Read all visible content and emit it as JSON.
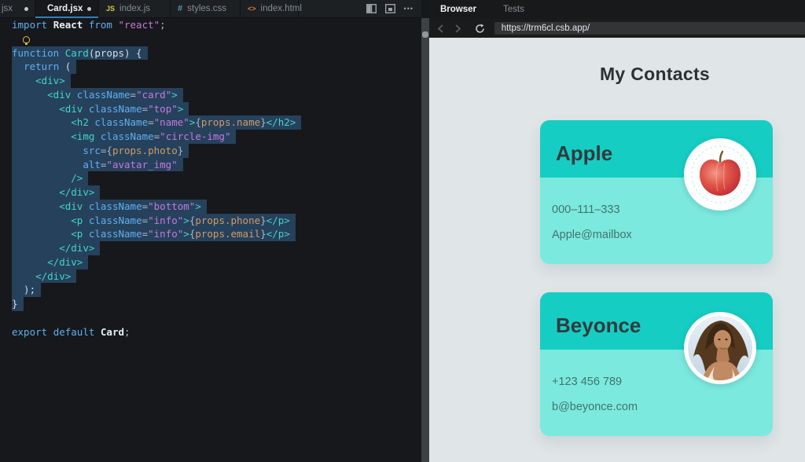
{
  "editor": {
    "tabs": [
      {
        "label": "jsx",
        "modified": true,
        "active": false
      },
      {
        "label": "Card.jsx",
        "icon": "react",
        "modified": true,
        "active": true
      },
      {
        "label": "index.js",
        "icon_text": "JS",
        "active": false
      },
      {
        "label": "styles.css",
        "icon_text": "#",
        "active": false
      },
      {
        "label": "index.html",
        "icon_text": "<>",
        "active": false
      }
    ],
    "more_icon": "•••",
    "code": {
      "lines": [
        {
          "t": [
            [
              "k",
              "import "
            ],
            [
              "w",
              "React"
            ],
            [
              "k",
              " from "
            ],
            [
              "s",
              "\"react\""
            ],
            [
              "p",
              ";"
            ]
          ]
        },
        {
          "bulb": true
        },
        {
          "sel": 1,
          "t": [
            [
              "k",
              "function "
            ],
            [
              "t",
              "Card"
            ],
            [
              "pl",
              "(props) {"
            ]
          ]
        },
        {
          "sel": 1,
          "t": [
            [
              "pl",
              "  "
            ],
            [
              "k",
              "return"
            ],
            [
              "pl",
              " ("
            ]
          ]
        },
        {
          "sel": 1,
          "t": [
            [
              "pl",
              "    "
            ],
            [
              "t",
              "<div>"
            ]
          ]
        },
        {
          "sel": 1,
          "t": [
            [
              "pl",
              "      "
            ],
            [
              "t",
              "<div"
            ],
            [
              "pl",
              " "
            ],
            [
              "a",
              "className"
            ],
            [
              "p",
              "="
            ],
            [
              "s",
              "\"card\""
            ],
            [
              "t",
              ">"
            ]
          ]
        },
        {
          "sel": 1,
          "t": [
            [
              "pl",
              "        "
            ],
            [
              "t",
              "<div"
            ],
            [
              "pl",
              " "
            ],
            [
              "a",
              "className"
            ],
            [
              "p",
              "="
            ],
            [
              "s",
              "\"top\""
            ],
            [
              "t",
              ">"
            ]
          ]
        },
        {
          "sel": 1,
          "t": [
            [
              "pl",
              "          "
            ],
            [
              "t",
              "<h2"
            ],
            [
              "pl",
              " "
            ],
            [
              "a",
              "className"
            ],
            [
              "p",
              "="
            ],
            [
              "s",
              "\"name\""
            ],
            [
              "t",
              ">"
            ],
            [
              "p",
              "{"
            ],
            [
              "o",
              "props.name"
            ],
            [
              "p",
              "}"
            ],
            [
              "t",
              "</h2>"
            ]
          ]
        },
        {
          "sel": 1,
          "t": [
            [
              "pl",
              "          "
            ],
            [
              "t",
              "<img"
            ],
            [
              "pl",
              " "
            ],
            [
              "a",
              "className"
            ],
            [
              "p",
              "="
            ],
            [
              "s",
              "\"circle-img\""
            ]
          ]
        },
        {
          "sel": 1,
          "t": [
            [
              "pl",
              "            "
            ],
            [
              "a",
              "src"
            ],
            [
              "p",
              "="
            ],
            [
              "p",
              "{"
            ],
            [
              "o",
              "props.photo"
            ],
            [
              "p",
              "}"
            ]
          ]
        },
        {
          "sel": 1,
          "t": [
            [
              "pl",
              "            "
            ],
            [
              "a",
              "alt"
            ],
            [
              "p",
              "="
            ],
            [
              "s",
              "\"avatar_img\""
            ]
          ]
        },
        {
          "sel": 1,
          "t": [
            [
              "pl",
              "          "
            ],
            [
              "t",
              "/>"
            ]
          ]
        },
        {
          "sel": 1,
          "t": [
            [
              "pl",
              "        "
            ],
            [
              "t",
              "</div>"
            ]
          ]
        },
        {
          "sel": 1,
          "t": [
            [
              "pl",
              "        "
            ],
            [
              "t",
              "<div"
            ],
            [
              "pl",
              " "
            ],
            [
              "a",
              "className"
            ],
            [
              "p",
              "="
            ],
            [
              "s",
              "\"bottom\""
            ],
            [
              "t",
              ">"
            ]
          ]
        },
        {
          "sel": 1,
          "t": [
            [
              "pl",
              "          "
            ],
            [
              "t",
              "<p"
            ],
            [
              "pl",
              " "
            ],
            [
              "a",
              "className"
            ],
            [
              "p",
              "="
            ],
            [
              "s",
              "\"info\""
            ],
            [
              "t",
              ">"
            ],
            [
              "p",
              "{"
            ],
            [
              "o",
              "props.phone"
            ],
            [
              "p",
              "}"
            ],
            [
              "t",
              "</p>"
            ]
          ]
        },
        {
          "sel": 1,
          "t": [
            [
              "pl",
              "          "
            ],
            [
              "t",
              "<p"
            ],
            [
              "pl",
              " "
            ],
            [
              "a",
              "className"
            ],
            [
              "p",
              "="
            ],
            [
              "s",
              "\"info\""
            ],
            [
              "t",
              ">"
            ],
            [
              "p",
              "{"
            ],
            [
              "o",
              "props.email"
            ],
            [
              "p",
              "}"
            ],
            [
              "t",
              "</p>"
            ]
          ]
        },
        {
          "sel": 1,
          "t": [
            [
              "pl",
              "        "
            ],
            [
              "t",
              "</div>"
            ]
          ]
        },
        {
          "sel": 1,
          "t": [
            [
              "pl",
              "      "
            ],
            [
              "t",
              "</div>"
            ]
          ]
        },
        {
          "sel": 1,
          "t": [
            [
              "pl",
              "    "
            ],
            [
              "t",
              "</div>"
            ]
          ]
        },
        {
          "sel": 1,
          "t": [
            [
              "pl",
              "  );"
            ]
          ]
        },
        {
          "sel": 1,
          "t": [
            [
              "pl",
              "}"
            ]
          ]
        },
        {
          "t": []
        },
        {
          "t": [
            [
              "k",
              "export "
            ],
            [
              "k",
              "default "
            ],
            [
              "w",
              "Card"
            ],
            [
              "p",
              ";"
            ]
          ]
        }
      ]
    }
  },
  "browser": {
    "tabs": [
      {
        "label": "Browser",
        "active": true
      },
      {
        "label": "Tests",
        "active": false
      }
    ],
    "url": "https://trm6cl.csb.app/",
    "preview": {
      "title": "My Contacts",
      "cards": [
        {
          "name": "Apple",
          "phone": "000–111–333",
          "email": "Apple@mailbox",
          "avatar": "apple-photo"
        },
        {
          "name": "Beyonce",
          "phone": "+123 456 789",
          "email": "b@beyonce.com",
          "avatar": "beyonce-photo"
        }
      ]
    }
  },
  "colors": {
    "tab_underline": "#3180b8",
    "selection": "#26415c",
    "card_top": "#16cdc3",
    "card_bottom": "#7ce9de",
    "preview_bg": "#e0e5e7",
    "info_text": "#40756f"
  }
}
